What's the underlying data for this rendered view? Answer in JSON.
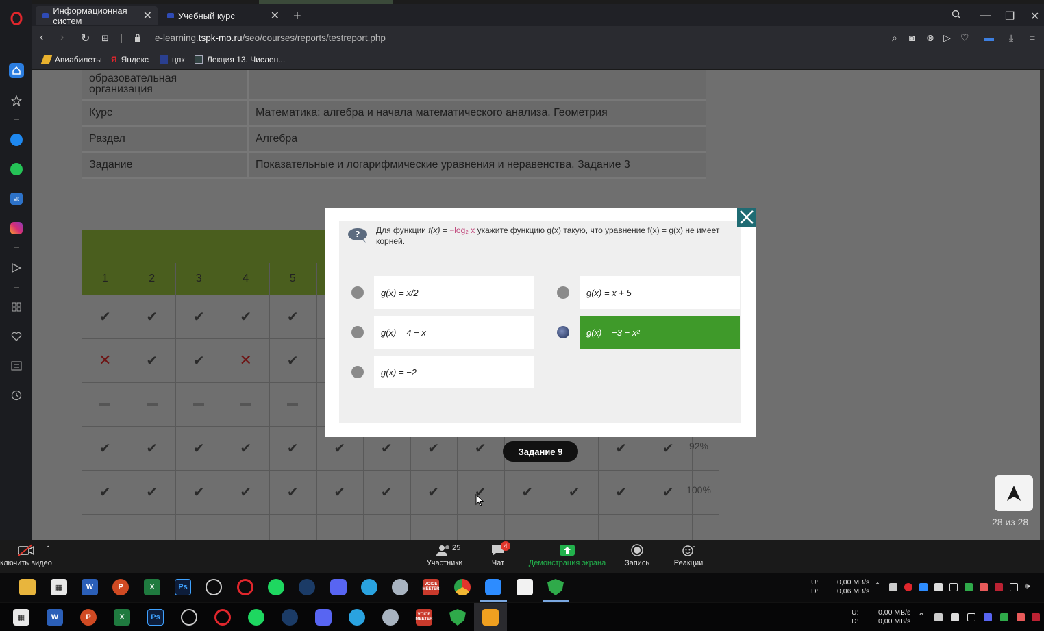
{
  "browser": {
    "tabs": [
      {
        "label": "Информационная систем"
      },
      {
        "label": "Учебный курс"
      }
    ],
    "url_prefix": "e-learning.",
    "url_domain": "tspk-mo.ru",
    "url_path": "/seo/courses/reports/testreport.php",
    "bookmarks": [
      {
        "label": "Авиабилеты"
      },
      {
        "label": "Яндекс"
      },
      {
        "label": "цпк"
      },
      {
        "label": "Лекция 13. Числен..."
      }
    ]
  },
  "info_table": {
    "rows": [
      {
        "key": "образовательная организация",
        "value": ""
      },
      {
        "key": "Курс",
        "value": "Математика: алгебра и начала математического анализа. Геометрия"
      },
      {
        "key": "Раздел",
        "value": "Алгебра"
      },
      {
        "key": "Задание",
        "value": "Показательные и логарифмические уравнения и неравенства. Задание 3"
      }
    ]
  },
  "grid": {
    "headers": [
      "1",
      "2",
      "3",
      "4",
      "5"
    ],
    "percents": [
      "92%",
      "100%"
    ],
    "task_badge": "Задание 9"
  },
  "pager": {
    "text": "28 из 28"
  },
  "modal": {
    "question_part1": "Для функции",
    "question_fx": "f(x) =",
    "question_formula": "−log₂ x",
    "question_part2": "укажите функцию g(x) такую, что уравнение f(x) = g(x) не имеет корней.",
    "options": [
      {
        "label": "g(x) = x/2",
        "selected": false
      },
      {
        "label": "g(x) = x + 5",
        "selected": false
      },
      {
        "label": "g(x) = 4 − x",
        "selected": false
      },
      {
        "label": "g(x) = −3 − x²",
        "selected": true
      },
      {
        "label": "g(x) = −2",
        "selected": false
      }
    ]
  },
  "zoom": {
    "video_label": "ключить видео",
    "participants_label": "Участники",
    "participants_count": "25",
    "chat_label": "Чат",
    "chat_badge": "4",
    "share_label": "Демонстрация экрана",
    "record_label": "Запись",
    "reactions_label": "Реакции"
  },
  "taskbar": {
    "net1_u": "U:",
    "net1_d": "D:",
    "net1_up": "0,00 MB/s",
    "net1_down": "0,06 MB/s",
    "net2_u": "U:",
    "net2_d": "D:",
    "net2_up": "0,00 MB/s",
    "net2_down": "0,00 MB/s",
    "voicemeeter": "VOICE MEETER"
  },
  "colors": {
    "accent_green": "#3f9a2a",
    "zoom_share_green": "#22b14c",
    "tab_accent": "#2f4bb5"
  }
}
